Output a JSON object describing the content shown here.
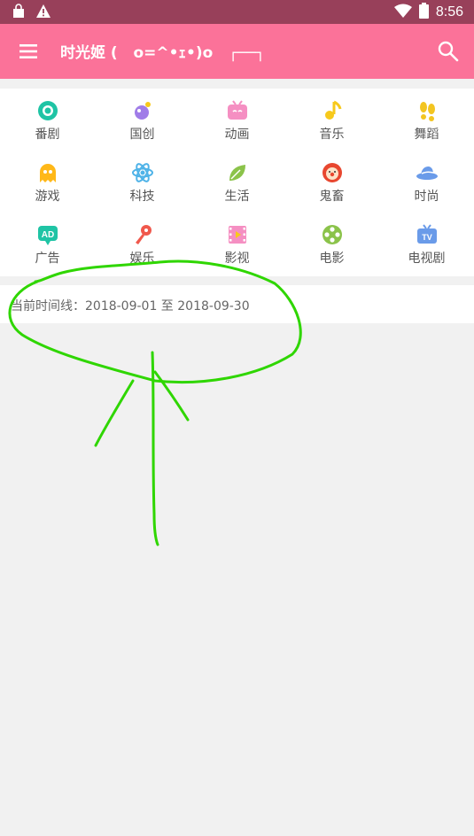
{
  "status_bar": {
    "time": "8:56",
    "left_icons": [
      "shopping-bag-icon",
      "warning-icon"
    ],
    "right_icons": [
      "wifi-icon",
      "battery-icon"
    ]
  },
  "app_bar": {
    "title": "时光姬 (   o=^•ｪ•)o   ┌──┐",
    "menu_icon": "hamburger-menu-icon",
    "search_icon": "search-icon",
    "background": "#fb7299"
  },
  "categories": [
    {
      "label": "番剧",
      "icon": "bangumi-icon",
      "color": "#1fc4a5"
    },
    {
      "label": "国创",
      "icon": "guochuang-icon",
      "color": "#a07ce8"
    },
    {
      "label": "动画",
      "icon": "tv-face-icon",
      "color": "#f58fc2"
    },
    {
      "label": "音乐",
      "icon": "music-note-icon",
      "color": "#f7c91b"
    },
    {
      "label": "舞蹈",
      "icon": "footprints-icon",
      "color": "#f3c521"
    },
    {
      "label": "游戏",
      "icon": "ghost-icon",
      "color": "#ffb818"
    },
    {
      "label": "科技",
      "icon": "atom-icon",
      "color": "#4fb3e8"
    },
    {
      "label": "生活",
      "icon": "leaf-icon",
      "color": "#8bc34a"
    },
    {
      "label": "鬼畜",
      "icon": "clown-icon",
      "color": "#e8472f"
    },
    {
      "label": "时尚",
      "icon": "hat-icon",
      "color": "#6a9be9"
    },
    {
      "label": "广告",
      "icon": "ad-icon",
      "color": "#1fc4a5"
    },
    {
      "label": "娱乐",
      "icon": "microphone-icon",
      "color": "#f0584c"
    },
    {
      "label": "影视",
      "icon": "film-icon",
      "color": "#f58fc2"
    },
    {
      "label": "电影",
      "icon": "film-reel-icon",
      "color": "#8bc34a"
    },
    {
      "label": "电视剧",
      "icon": "tv-icon",
      "color": "#6a9be9"
    }
  ],
  "timeline": {
    "label": "当前时间线：2018-09-01 至 2018-09-30"
  },
  "annotation": {
    "color": "#2fd600"
  }
}
